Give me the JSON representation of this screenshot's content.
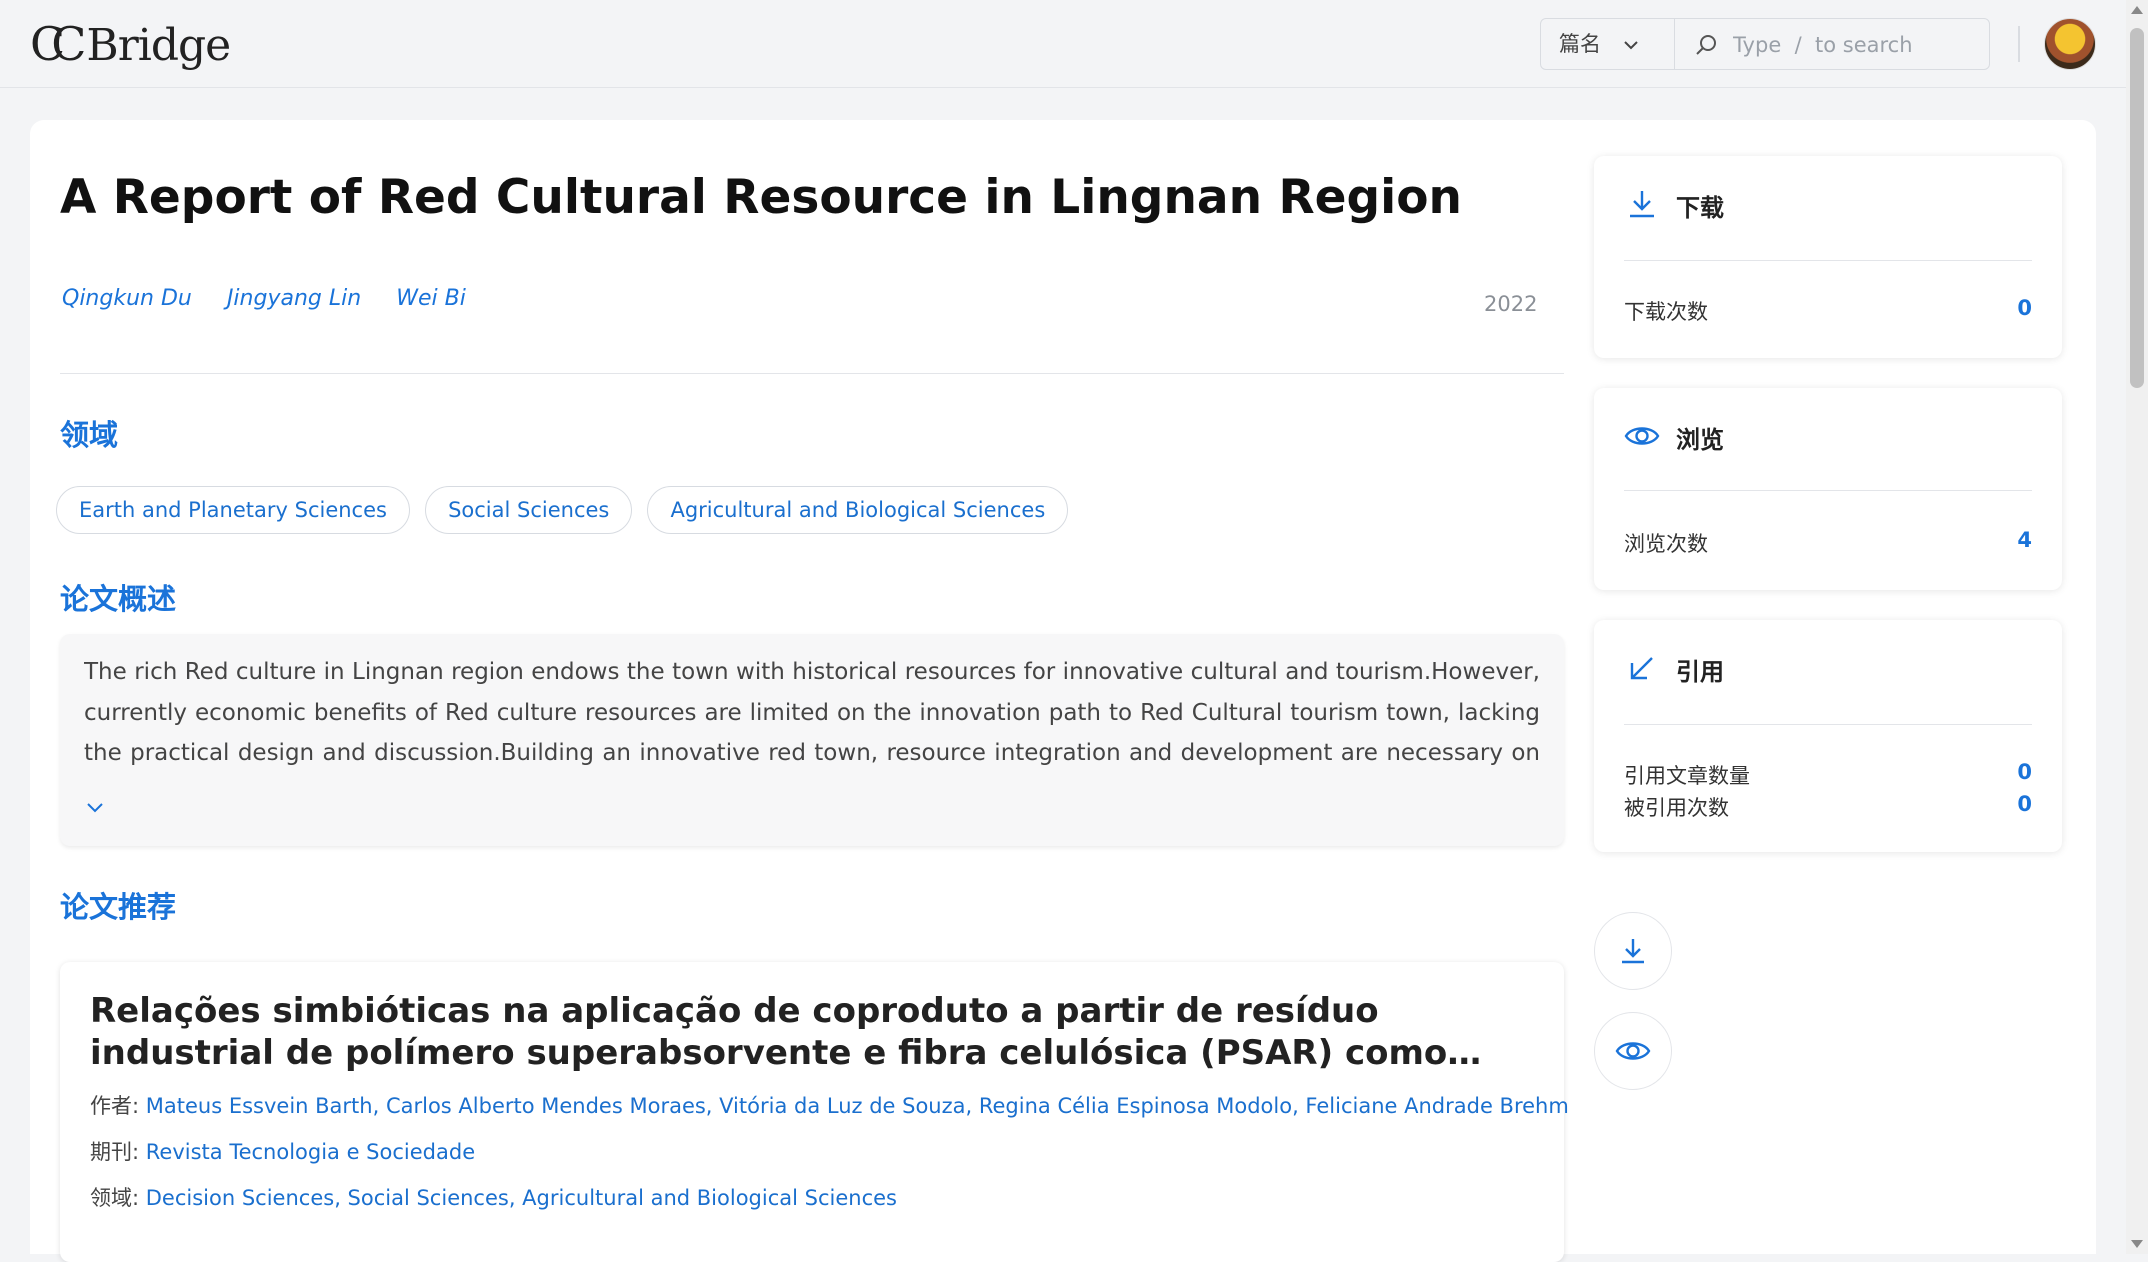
{
  "header": {
    "logo": "CCBridge",
    "search_scope": "篇名",
    "search_placeholder": "Type  /  to search"
  },
  "paper": {
    "title": "A Report of Red Cultural Resource in Lingnan Region",
    "authors": [
      "Qingkun Du",
      "Jingyang Lin",
      "Wei Bi"
    ],
    "year": "2022"
  },
  "sections": {
    "fields_heading": "领域",
    "abstract_heading": "论文概述",
    "recommend_heading": "论文推荐"
  },
  "fields": [
    "Earth and Planetary Sciences",
    "Social Sciences",
    "Agricultural and Biological Sciences"
  ],
  "abstract": "The rich Red culture in Lingnan region endows the town with historical resources for innovative cultural and tourism.However, currently economic benefits of Red culture resources are limited on the innovation path to Red Cultural tourism town, lacking the practical design and discussion.Building an innovative red town, resource integration and development are necessary on the basis of explori...",
  "recommendation": {
    "title": "Relações simbióticas na aplicação de coproduto a partir de resíduo industrial de polímero superabsorvente e fibra celulósica (PSAR) como agente de cura interna em...",
    "authors_label": "作者:",
    "authors": "Mateus Essvein Barth, Carlos Alberto Mendes Moraes, Vitória da Luz de Souza, Regina Célia Espinosa Modolo, Feliciane Andrade Brehm",
    "journal_label": "期刊:",
    "journal": "Revista Tecnologia e Sociedade",
    "fields_label": "领域:",
    "fields": "Decision Sciences, Social Sciences, Agricultural and Biological Sciences"
  },
  "stats": {
    "download": {
      "title": "下载",
      "count_label": "下载次数",
      "count": "0"
    },
    "views": {
      "title": "浏览",
      "count_label": "浏览次数",
      "count": "4"
    },
    "citations": {
      "title": "引用",
      "refs_label": "引用文章数量",
      "refs": "0",
      "cited_label": "被引用次数",
      "cited": "0"
    }
  },
  "colors": {
    "accent": "#1a73d9",
    "background": "#f3f4f6"
  }
}
